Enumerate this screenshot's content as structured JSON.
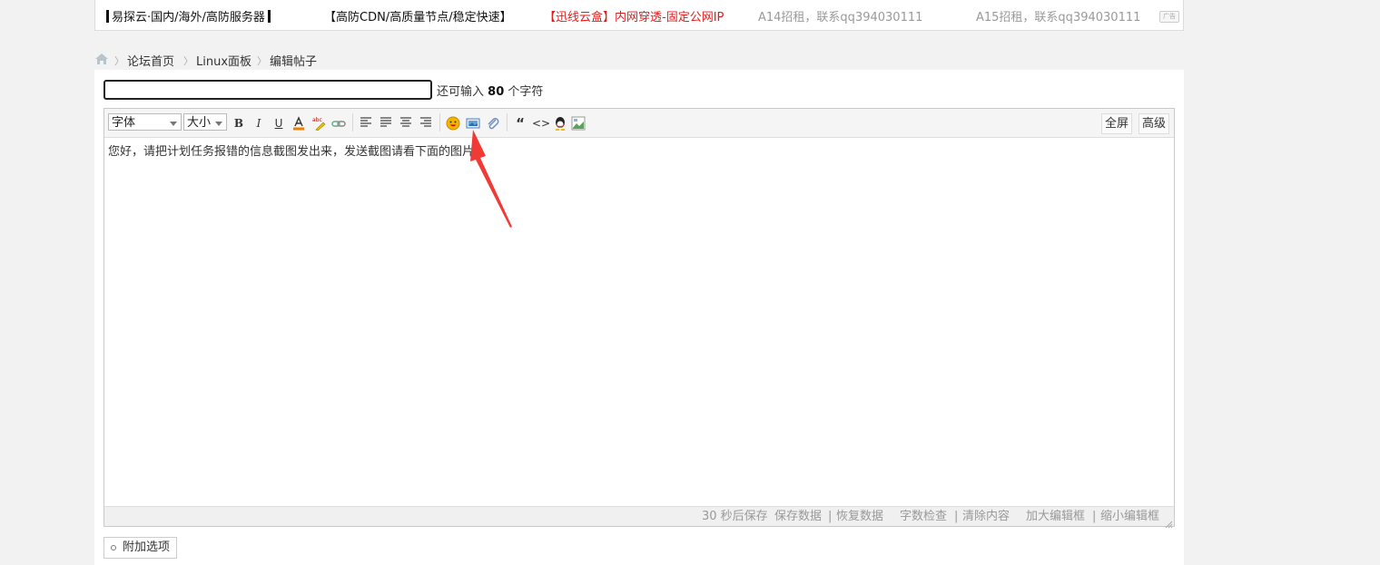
{
  "ads": [
    {
      "text": "易探云·国内/海外/高防服务器"
    },
    {
      "text": "【高防CDN/高质量节点/稳定快速】"
    },
    {
      "text": "【迅线云盒】内网穿透-固定公网IP"
    },
    {
      "text": "A14招租，联系qq394030111"
    },
    {
      "text": "A15招租，联系qq394030111"
    }
  ],
  "ad_tag": "广告",
  "breadcrumb": {
    "items": [
      "论坛首页",
      "Linux面板",
      "编辑帖子"
    ]
  },
  "subject": {
    "value": "",
    "remain_prefix": "还可输入",
    "remain_count": "80",
    "remain_suffix": "个字符"
  },
  "toolbar": {
    "font_select": "字体",
    "size_select": "大小",
    "bold": "B",
    "italic": "I",
    "underline": "U",
    "quote": "“",
    "code": "<>",
    "fullscreen": "全屏",
    "advanced": "高级"
  },
  "editor": {
    "content": "您好，请把计划任务报错的信息截图发出来，发送截图请看下面的图片"
  },
  "status": {
    "autosave": "30 秒后保存",
    "save_data": "保存数据",
    "restore_data": "恢复数据",
    "word_check": "字数检查",
    "clear": "清除内容",
    "enlarge": "加大编辑框",
    "shrink": "缩小编辑框",
    "sep": "|"
  },
  "extra_options": "附加选项",
  "colors": {
    "ad_red": "#e01b1b",
    "annotation": "#f03a35",
    "border": "#c9c9c9"
  }
}
